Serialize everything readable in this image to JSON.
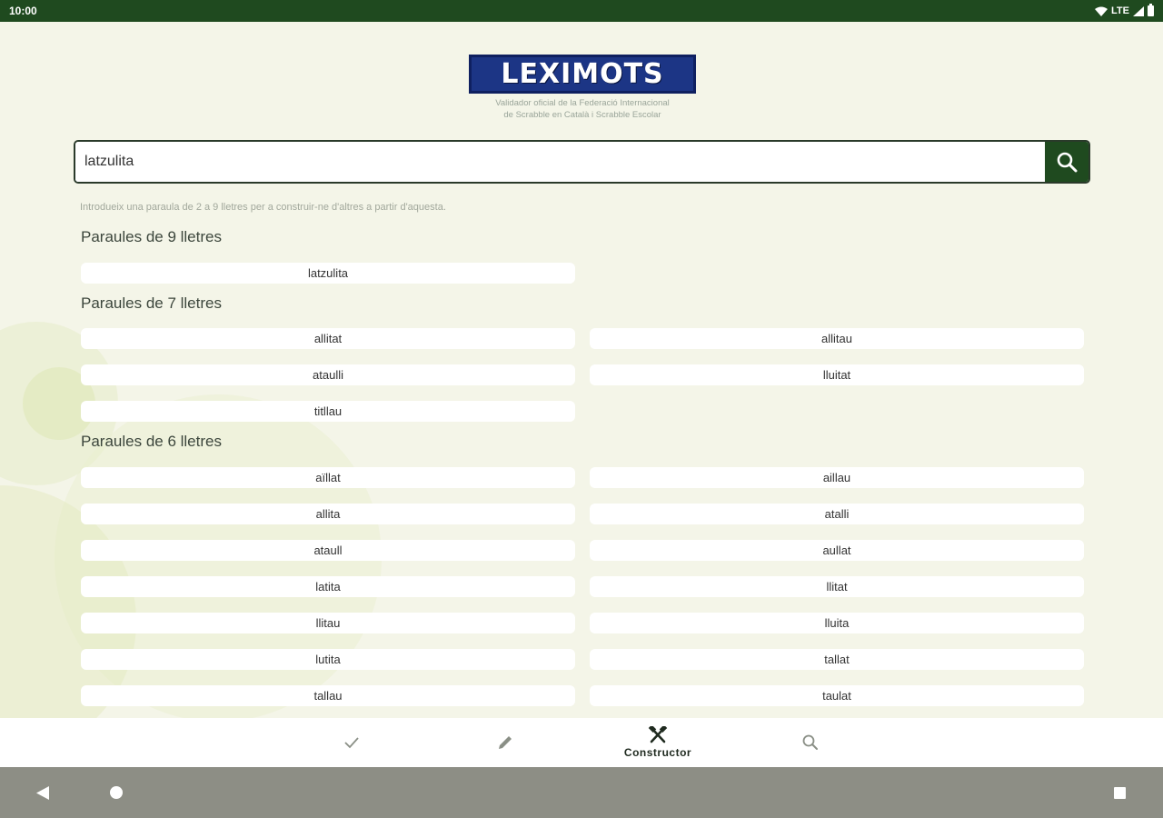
{
  "status_bar": {
    "time": "10:00",
    "network": "LTE"
  },
  "logo": {
    "text": "LEXIMOTS",
    "subtitle_line1": "Validador oficial de la Federació Internacional",
    "subtitle_line2": "de Scrabble en Català i Scrabble Escolar"
  },
  "search": {
    "value": "latzulita"
  },
  "hint": "Introdueix una paraula de 2 a 9 lletres per a construir-ne d'altres a partir d'aquesta.",
  "sections": [
    {
      "title": "Paraules de 9 lletres",
      "words": [
        "latzulita"
      ]
    },
    {
      "title": "Paraules de 7 lletres",
      "words": [
        "allitat",
        "allitau",
        "ataulli",
        "lluitat",
        "titllau"
      ]
    },
    {
      "title": "Paraules de 6 lletres",
      "words": [
        "aïllat",
        "aillau",
        "allita",
        "atalli",
        "ataull",
        "aullat",
        "latita",
        "llitat",
        "llitau",
        "lluita",
        "lutita",
        "tallat",
        "tallau",
        "taulat"
      ]
    }
  ],
  "bottom_nav": {
    "items": [
      {
        "icon": "check-icon",
        "label": ""
      },
      {
        "icon": "pencil-icon",
        "label": ""
      },
      {
        "icon": "tools-icon",
        "label": "Constructor",
        "active": true
      },
      {
        "icon": "search-icon",
        "label": ""
      }
    ]
  },
  "colors": {
    "primary": "#1f4a1f",
    "logo_blue": "#1c3585",
    "background": "#f4f5e8"
  }
}
